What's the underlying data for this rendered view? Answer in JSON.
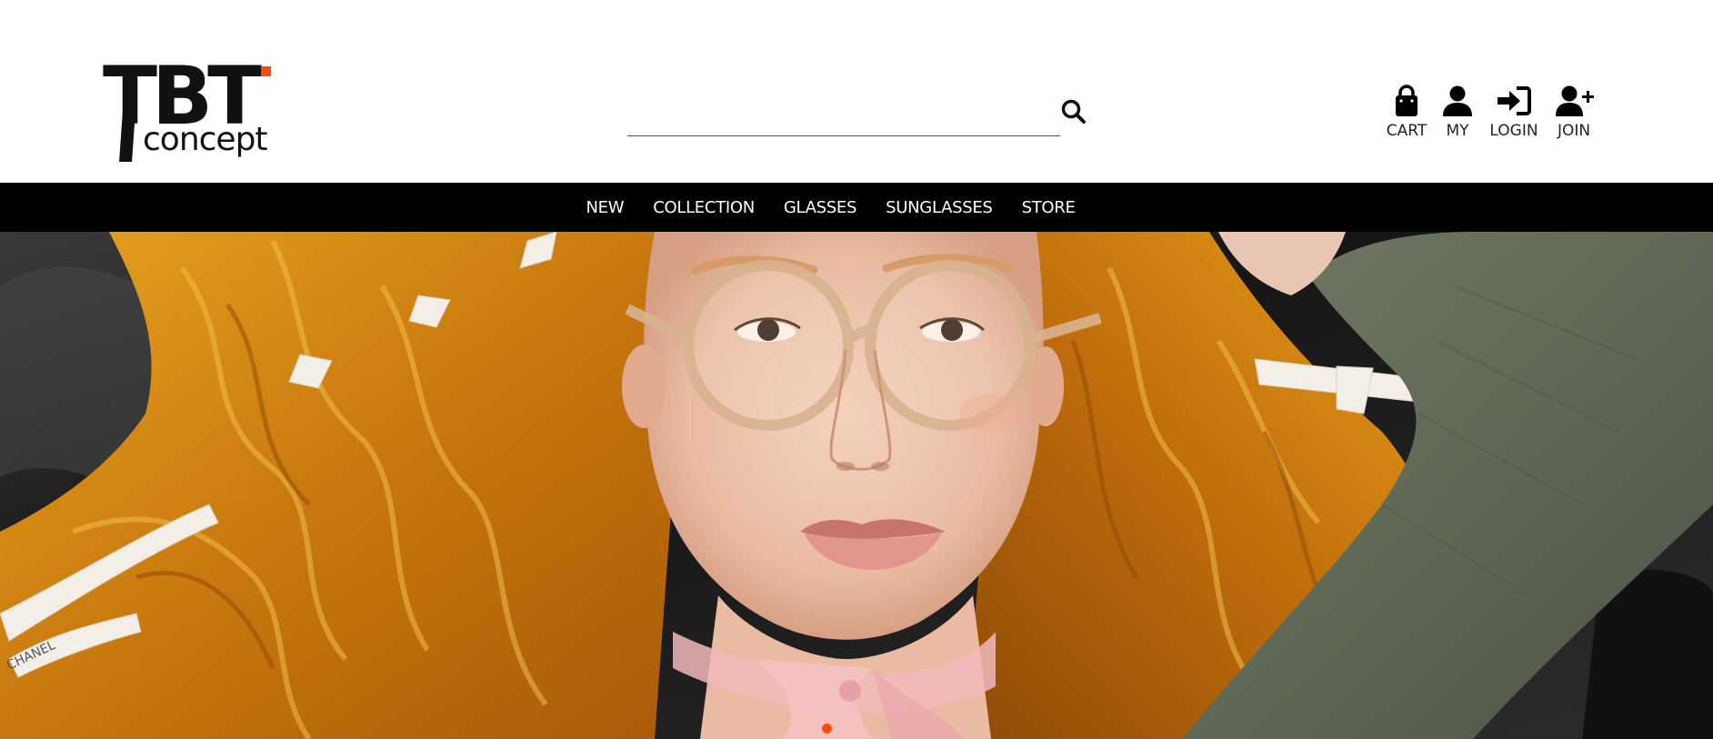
{
  "brand": {
    "logo_main": "TBT",
    "logo_sub": "concept",
    "accent_color": "#ff4a0a"
  },
  "search": {
    "placeholder": "",
    "value": "",
    "icon": "search-icon"
  },
  "user_nav": {
    "cart_label": "CART",
    "my_label": "MY",
    "login_label": "LOGIN",
    "join_label": "JOIN",
    "icons": [
      "shopping-bag-icon",
      "user-icon",
      "sign-in-icon",
      "user-plus-icon"
    ]
  },
  "nav": {
    "items": [
      "NEW",
      "COLLECTION",
      "GLASSES",
      "SUNGLASSES",
      "STORE"
    ]
  },
  "hero": {
    "image": "model-with-orange-hair-wearing-round-glasses",
    "slide_dots": 2,
    "active_dot": 0,
    "dot_active_color": "#ff4a0a"
  }
}
